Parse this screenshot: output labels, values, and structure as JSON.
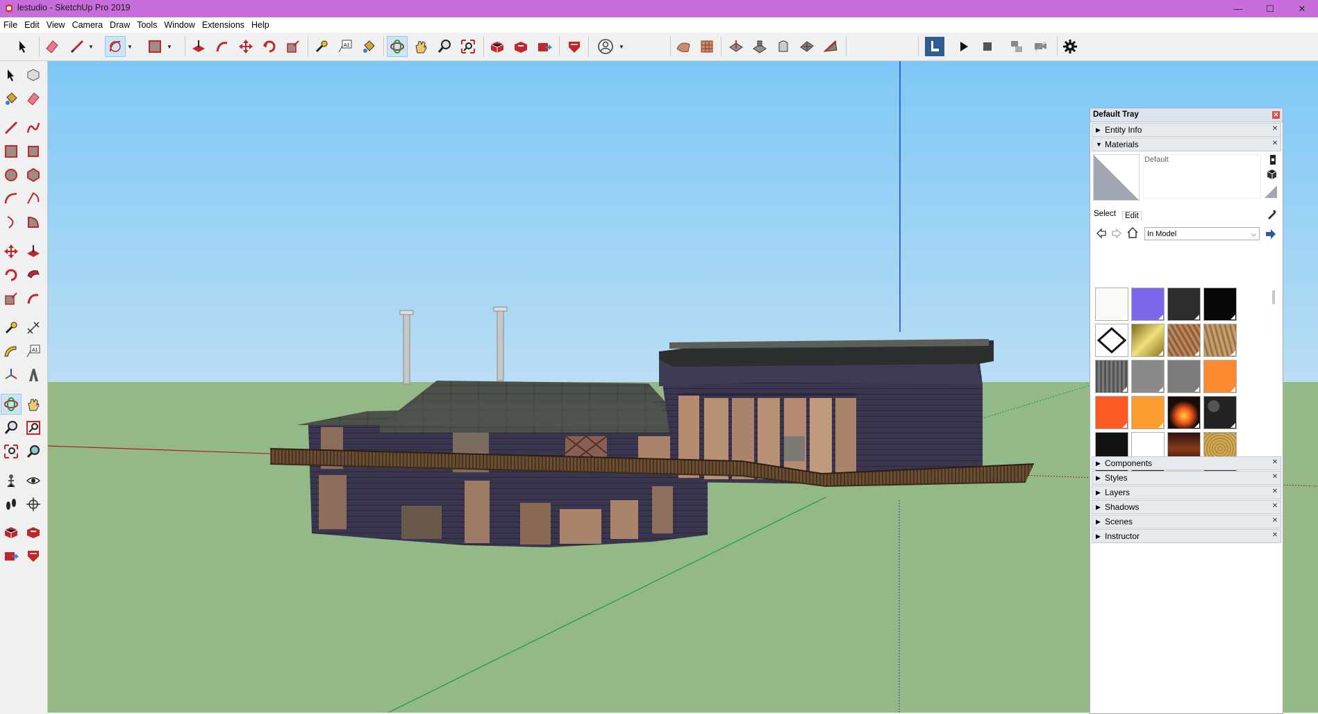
{
  "window": {
    "title": "lestudio - SketchUp Pro 2019",
    "min": "—",
    "max": "☐",
    "close": "✕"
  },
  "menu": [
    "File",
    "Edit",
    "View",
    "Camera",
    "Draw",
    "Tools",
    "Window",
    "Extensions",
    "Help"
  ],
  "colors": {
    "titlebar": "#c86edc",
    "sky_top": "#7ec8f6",
    "sky_bottom": "#b9ddf4",
    "ground": "#93b987",
    "accent": "#3d79b8"
  },
  "tray": {
    "title": "Default Tray",
    "panels_top": [
      {
        "label": "Entity Info",
        "open": false
      },
      {
        "label": "Materials",
        "open": true
      }
    ],
    "materials": {
      "current_name": "Default",
      "tabs": [
        "Select",
        "Edit"
      ],
      "library": "In Model",
      "swatches": [
        "#fbf9f6",
        "#7b67ea",
        "#2c2c2c",
        "#070707",
        "outline",
        "gold",
        "wood1",
        "wood2",
        "bark",
        "#8a8a88",
        "#7c7d7b",
        "#fa8a2f",
        "#fc5a22",
        "#fc9c2e",
        "fire",
        "stone",
        "#111111",
        "#ffffff",
        "darkwood",
        "cork",
        "#1c1c1c",
        "#222222",
        "#d8d6c8",
        "#3a3a3a"
      ]
    },
    "panels_bottom": [
      "Components",
      "Styles",
      "Layers",
      "Shadows",
      "Scenes",
      "Instructor"
    ]
  }
}
